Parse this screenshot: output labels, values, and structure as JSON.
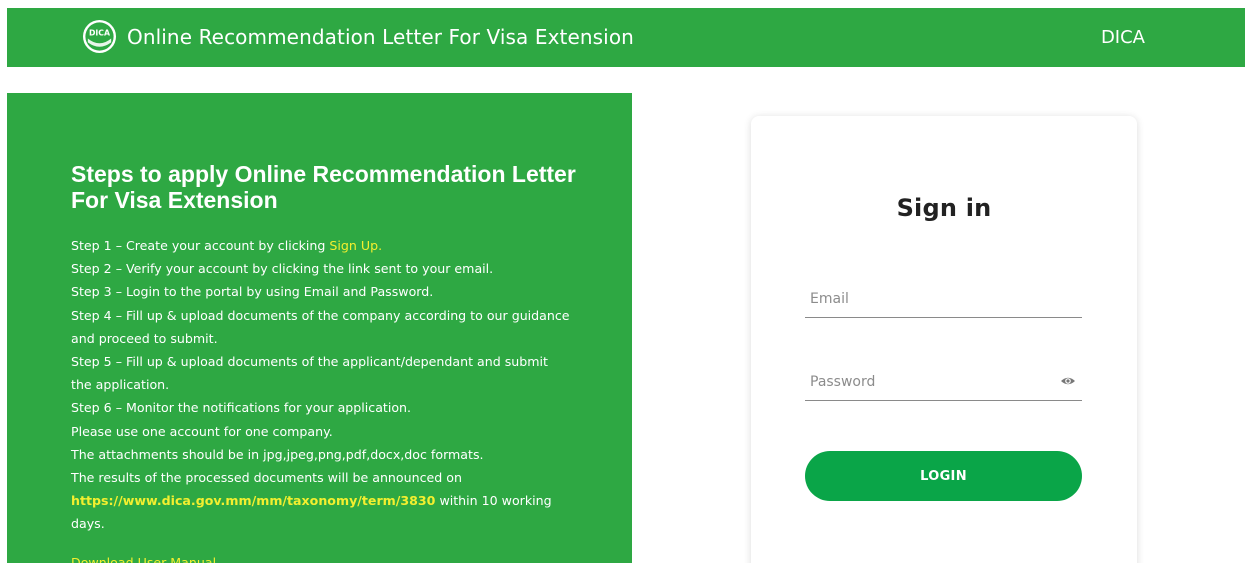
{
  "header": {
    "logo_text": "DICA",
    "title": "Online Recommendation Letter For Visa Extension",
    "brand": "DICA"
  },
  "info": {
    "heading": "Steps to apply Online Recommendation Letter For Visa Extension",
    "step1_prefix": "Step 1 – Create your account by clicking ",
    "step1_link": "Sign Up.",
    "step2": "Step 2 – Verify your account by clicking the link sent to your email.",
    "step3": "Step 3 – Login to the portal by using Email and Password.",
    "step4": "Step 4 – Fill up & upload documents of the company according to our guidance and proceed to submit.",
    "step5": "Step 5 – Fill up & upload documents of the applicant/dependant and submit the application.",
    "step6": "Step 6 – Monitor the notifications for your application.",
    "note1": "Please use one account for one company.",
    "note2": "The attachments should be in jpg,jpeg,png,pdf,docx,doc formats.",
    "note3_prefix": "The results of the processed documents will be announced on",
    "note3_link": "https://www.dica.gov.mm/mm/taxonomy/term/3830",
    "note3_suffix": " within 10 working days.",
    "manual_link": "Download User Manual"
  },
  "signin": {
    "title": "Sign in",
    "email_placeholder": "Email",
    "email_value": "",
    "password_placeholder": "Password",
    "password_value": "",
    "login_label": "LOGIN"
  },
  "colors": {
    "primary_green": "#2ea843",
    "button_green": "#0aa548",
    "link_yellow": "#f3ef2f"
  },
  "icons": {
    "logo": "dica-logo-icon",
    "password_toggle": "eye-icon"
  }
}
